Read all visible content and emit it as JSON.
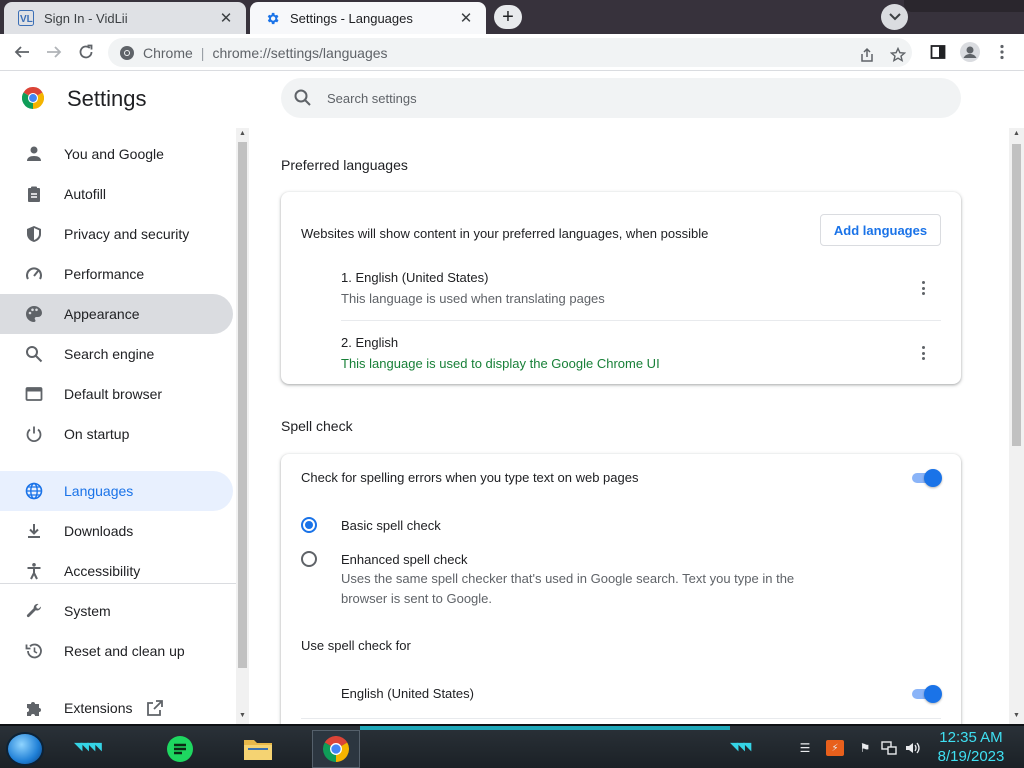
{
  "browser": {
    "tabs": [
      {
        "title": "Sign In - VidLii",
        "active": false
      },
      {
        "title": "Settings - Languages",
        "active": true
      }
    ],
    "new_tab_symbol": "+",
    "close_symbol": "✕",
    "omnibox": {
      "chip": "Chrome",
      "separator": "|",
      "url": "chrome://settings/languages"
    }
  },
  "settings": {
    "title": "Settings",
    "search_placeholder": "Search settings",
    "nav": [
      {
        "label": "You and Google",
        "icon": "person-icon"
      },
      {
        "label": "Autofill",
        "icon": "clipboard-icon"
      },
      {
        "label": "Privacy and security",
        "icon": "shield-icon"
      },
      {
        "label": "Performance",
        "icon": "speedometer-icon"
      },
      {
        "label": "Appearance",
        "icon": "palette-icon"
      },
      {
        "label": "Search engine",
        "icon": "search-icon"
      },
      {
        "label": "Default browser",
        "icon": "browser-window-icon"
      },
      {
        "label": "On startup",
        "icon": "power-icon"
      },
      {
        "label": "Languages",
        "icon": "globe-icon",
        "selected": true
      },
      {
        "label": "Downloads",
        "icon": "download-icon"
      },
      {
        "label": "Accessibility",
        "icon": "accessibility-icon"
      },
      {
        "label": "System",
        "icon": "wrench-icon"
      },
      {
        "label": "Reset and clean up",
        "icon": "restore-icon"
      },
      {
        "label": "Extensions",
        "icon": "puzzle-icon"
      }
    ],
    "preferred_languages": {
      "section_title": "Preferred languages",
      "header": "Websites will show content in your preferred languages, when possible",
      "add_button": "Add languages",
      "languages": [
        {
          "name": "1. English (United States)",
          "desc": "This language is used when translating pages"
        },
        {
          "name": "2. English",
          "desc": "This language is used to display the Google Chrome UI"
        }
      ]
    },
    "spell_check": {
      "section_title": "Spell check",
      "toggle_label": "Check for spelling errors when you type text on web pages",
      "toggle_on": true,
      "basic_label": "Basic spell check",
      "enhanced_label": "Enhanced spell check",
      "enhanced_desc": "Uses the same spell checker that's used in Google search. Text you type in the browser is sent to Google.",
      "selected": "basic",
      "use_for_label": "Use spell check for",
      "languages": [
        {
          "name": "English (United States)",
          "on": true
        }
      ]
    }
  },
  "taskbar": {
    "time": "12:35 AM",
    "date": "8/19/2023"
  },
  "colors": {
    "accent": "#1a73e8",
    "selected_bg": "#e8f0fe",
    "green": "#188038",
    "clock": "#3fe0f2"
  }
}
